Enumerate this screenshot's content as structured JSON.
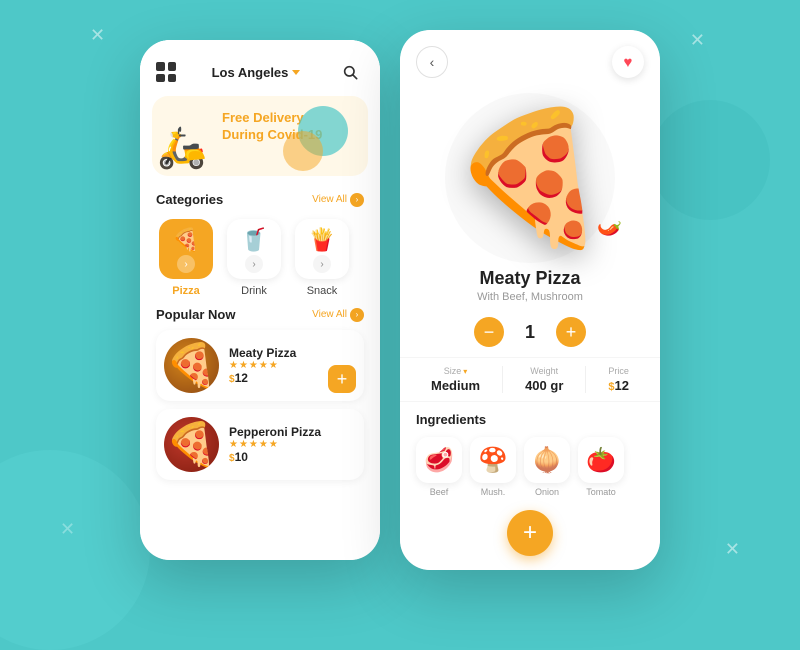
{
  "background": {
    "color": "#4ec8c8"
  },
  "left_phone": {
    "header": {
      "location": "Los Angeles",
      "location_chevron": "▾"
    },
    "banner": {
      "main_text": "Free Delivery\nDuring Covid-19",
      "icon": "🛵"
    },
    "categories": {
      "section_title": "Categories",
      "view_all_label": "View All",
      "items": [
        {
          "icon": "🍕",
          "label": "Pizza",
          "active": true
        },
        {
          "icon": "🥤",
          "label": "Drink",
          "active": false
        },
        {
          "icon": "🍟",
          "label": "Snack",
          "active": false
        }
      ]
    },
    "popular": {
      "section_title": "Popular Now",
      "view_all_label": "View All",
      "items": [
        {
          "name": "Meaty Pizza",
          "stars": "★★★★★",
          "price": "12",
          "icon": "🍕"
        },
        {
          "name": "Pepperoni Pizza",
          "stars": "★★★★★",
          "price": "10",
          "icon": "🍕"
        }
      ]
    }
  },
  "right_phone": {
    "title": "Meaty Pizza",
    "subtitle": "With Beef, Mushroom",
    "pizza_icon": "🍕",
    "quantity": "1",
    "size_label": "Size",
    "size_value": "Medium",
    "weight_label": "Weight",
    "weight_value": "400 gr",
    "price_label": "Price",
    "price_symbol": "$",
    "price_value": "12",
    "ingredients_title": "Ingredients",
    "ingredients": [
      {
        "icon": "🥩",
        "label": "Beef"
      },
      {
        "icon": "🍄",
        "label": "Mushroom"
      },
      {
        "icon": "🧅",
        "label": "Onion"
      },
      {
        "icon": "🍅",
        "label": "Tomato"
      }
    ]
  }
}
